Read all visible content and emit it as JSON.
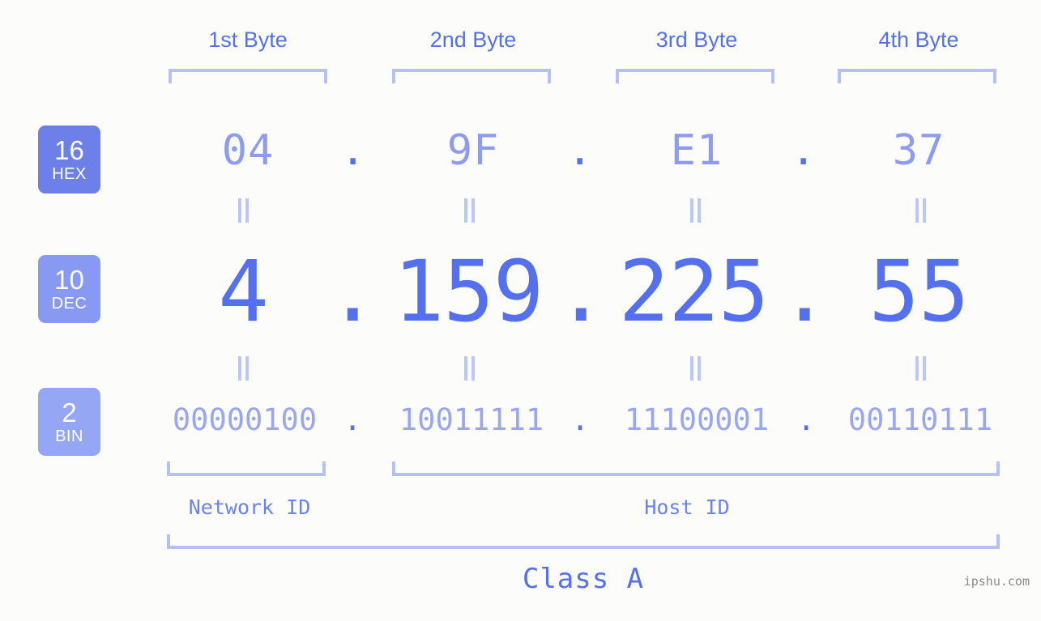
{
  "ip": {
    "decimal": "4.159.225.55",
    "hexadecimal": "04.9F.E1.37",
    "binary": "00000100.10011111.11100001.00110111"
  },
  "colors": {
    "background": "#fcfdfa",
    "accent_strong": "#5470ee",
    "accent_mid": "#8d9cf2",
    "accent_light": "#b4c0f7",
    "badge_hex": "#6d80e9",
    "badge_dec": "#8799f0",
    "badge_bin": "#95a6f5",
    "watermark": "#8a8a8a"
  },
  "byte_headers": [
    {
      "label": "1st Byte"
    },
    {
      "label": "2nd Byte"
    },
    {
      "label": "3rd Byte"
    },
    {
      "label": "4th Byte"
    }
  ],
  "rows": [
    {
      "base_number": "16",
      "base_name": "HEX",
      "cells": [
        "04",
        "9F",
        "E1",
        "37"
      ],
      "separator": "."
    },
    {
      "base_number": "10",
      "base_name": "DEC",
      "cells": [
        "4",
        "159",
        "225",
        "55"
      ],
      "separator": "."
    },
    {
      "base_number": "2",
      "base_name": "BIN",
      "cells": [
        "00000100",
        "10011111",
        "11100001",
        "00110111"
      ],
      "separator": "."
    }
  ],
  "equality_symbol": "||",
  "segments": {
    "network_id": "Network ID",
    "host_id": "Host ID"
  },
  "class": {
    "label": "Class A"
  },
  "watermark": {
    "text": "ipshu.com"
  }
}
